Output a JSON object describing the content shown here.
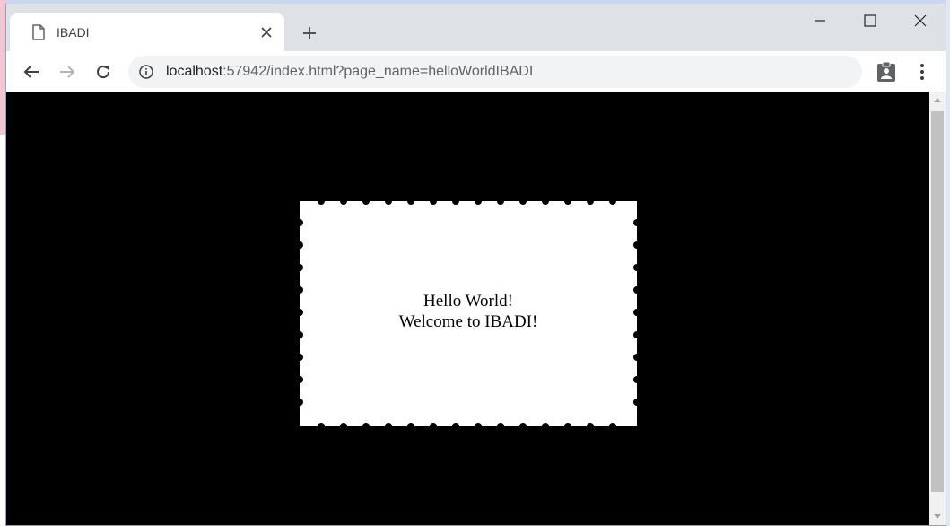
{
  "browser": {
    "tab": {
      "title": "IBADI",
      "icon": "document-icon"
    },
    "address": {
      "host": "localhost",
      "rest": ":57942/index.html?page_name=helloWorldIBADI"
    }
  },
  "page": {
    "line1": "Hello World!",
    "line2": "Welcome to IBADI!"
  },
  "colors": {
    "page_background": "#000000",
    "card_background": "#ffffff"
  }
}
